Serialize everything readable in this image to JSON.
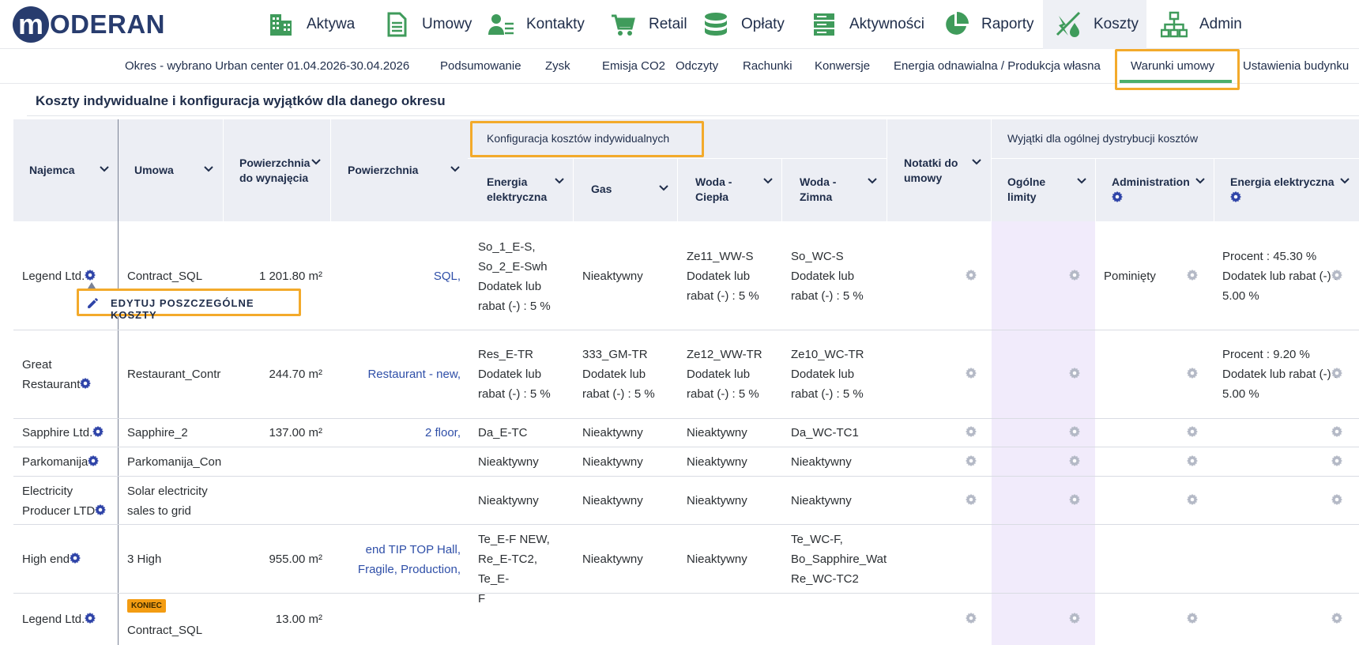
{
  "brand": {
    "logo_letter": "m",
    "logo_text": "ODERAN"
  },
  "nav": [
    {
      "label": "Aktywa",
      "icon": "building-icon"
    },
    {
      "label": "Umowy",
      "icon": "document-icon"
    },
    {
      "label": "Kontakty",
      "icon": "contacts-icon"
    },
    {
      "label": "Retail",
      "icon": "cart-icon"
    },
    {
      "label": "Opłaty",
      "icon": "coins-icon"
    },
    {
      "label": "Aktywności",
      "icon": "activities-icon"
    },
    {
      "label": "Raporty",
      "icon": "pie-chart-icon"
    },
    {
      "label": "Koszty",
      "icon": "costs-icon",
      "active": true
    },
    {
      "label": "Admin",
      "icon": "org-chart-icon"
    }
  ],
  "subnav": {
    "period": "Okres - wybrano Urban center 01.04.2026-30.04.2026",
    "items": [
      "Podsumowanie",
      "Zysk",
      "Emisja CO2",
      "Odczyty",
      "Rachunki",
      "Konwersje",
      "Energia odnawialna / Produkcja własna",
      "Warunki umowy",
      "Ustawienia budynku"
    ],
    "active": "Warunki umowy"
  },
  "section_title": "Koszty indywidualne i konfiguracja wyjątków dla danego okresu",
  "table": {
    "headers": {
      "tenant": "Najemca",
      "contract": "Umowa",
      "rentable_area": "Powierzchnia do wynajęcia",
      "area": "Powierzchnia",
      "group_individual": "Konfiguracja kosztów indywidualnych",
      "electricity": "Energia elektryczna",
      "gas": "Gas",
      "water_hot": "Woda - Ciepła",
      "water_cold": "Woda - Zimna",
      "notes": "Notatki do umowy",
      "group_exceptions": "Wyjątki dla ogólnej dystrybucji kosztów",
      "general_limits": "Ogólne limity",
      "administration": "Administration",
      "ex_electricity": "Energia elektryczna"
    },
    "edit_action": "EDYTUJ POSZCZEGÓLNE KOSZTY",
    "end_badge": "KONIEC",
    "rows": [
      {
        "tenant": "Legend Ltd.",
        "contract": "Contract_SQL",
        "rentable": "1 201.80 m²",
        "area": "SQL,",
        "el": [
          "So_1_E-S,",
          "So_2_E-Swh",
          "Dodatek lub",
          "rabat (-) : 5 %"
        ],
        "gas": [
          "Nieaktywny"
        ],
        "hot": [
          "Ze11_WW-S",
          "Dodatek lub",
          "rabat (-) : 5 %"
        ],
        "cold": [
          "So_WC-S",
          "Dodatek lub",
          "rabat (-) : 5 %"
        ],
        "admin": "Pominięty",
        "ex_el": [
          "Procent : 45.30 %",
          "Dodatek lub rabat (-) :",
          "5.00 %"
        ]
      },
      {
        "tenant": [
          "Great",
          "Restaurant"
        ],
        "contract": "Restaurant_Contr",
        "rentable": "244.70 m²",
        "area": "Restaurant - new,",
        "el": [
          "Res_E-TR",
          "Dodatek lub",
          "rabat (-) : 5 %"
        ],
        "gas": [
          "333_GM-TR",
          "Dodatek lub",
          "rabat (-) : 5 %"
        ],
        "hot": [
          "Ze12_WW-TR",
          "Dodatek lub",
          "rabat (-) : 5 %"
        ],
        "cold": [
          "Ze10_WC-TR",
          "Dodatek lub",
          "rabat (-) : 5 %"
        ],
        "admin": "",
        "ex_el": [
          "Procent : 9.20 %",
          "Dodatek lub rabat (-) :",
          "5.00 %"
        ]
      },
      {
        "tenant": "Sapphire Ltd.",
        "contract": "Sapphire_2",
        "rentable": "137.00 m²",
        "area": "2 floor,",
        "el": [
          "Da_E-TC"
        ],
        "gas": [
          "Nieaktywny"
        ],
        "hot": [
          "Nieaktywny"
        ],
        "cold": [
          "Da_WC-TC1"
        ]
      },
      {
        "tenant": "Parkomanija",
        "contract": "Parkomanija_Con",
        "rentable": "",
        "area": "",
        "el": [
          "Nieaktywny"
        ],
        "gas": [
          "Nieaktywny"
        ],
        "hot": [
          "Nieaktywny"
        ],
        "cold": [
          "Nieaktywny"
        ]
      },
      {
        "tenant": [
          "Electricity",
          "Producer LTD"
        ],
        "contract": [
          "Solar electricity",
          "sales to grid"
        ],
        "rentable": "",
        "area": "",
        "el": [
          "Nieaktywny"
        ],
        "gas": [
          "Nieaktywny"
        ],
        "hot": [
          "Nieaktywny"
        ],
        "cold": [
          "Nieaktywny"
        ]
      },
      {
        "tenant": "High end",
        "contract": "3 High",
        "rentable": "955.00 m²",
        "area": [
          "end TIP TOP Hall,",
          "Fragile, Production,"
        ],
        "el": [
          "Te_E-F NEW,",
          "Re_E-TC2, Te_E-",
          "F"
        ],
        "gas": [
          "Nieaktywny"
        ],
        "hot": [
          "Nieaktywny"
        ],
        "cold": [
          "Te_WC-F,",
          "Bo_Sapphire_Wate",
          "Re_WC-TC2"
        ]
      },
      {
        "tenant": "Legend Ltd.",
        "contract": "Contract_SQL",
        "rentable": "13.00 m²",
        "area": ""
      }
    ]
  },
  "colors": {
    "highlight": "#f3aa2b",
    "active_underline": "#4caf6b",
    "header_bg": "#eceef4",
    "purple_col": "#f1ebfb",
    "link": "#2f4fa8",
    "brand": "#283c6e",
    "nav_icon": "#3f9b5b"
  }
}
